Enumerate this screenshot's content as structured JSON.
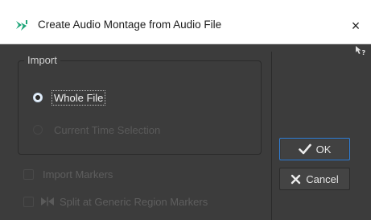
{
  "window": {
    "title": "Create Audio Montage from Audio File",
    "close_label": "×"
  },
  "import_group": {
    "title": "Import",
    "options": [
      {
        "label": "Whole File",
        "checked": true,
        "enabled": true
      },
      {
        "label": "Current Time Selection",
        "checked": false,
        "enabled": false
      }
    ]
  },
  "checkboxes": [
    {
      "label": "Import Markers",
      "checked": false,
      "enabled": false
    },
    {
      "label": "Split at Generic Region Markers",
      "checked": false,
      "enabled": false
    }
  ],
  "buttons": {
    "ok_label": "OK",
    "cancel_label": "Cancel"
  },
  "colors": {
    "accent": "#2f7fd8",
    "app_icon": "#1fa67a",
    "background": "#3c3c3c",
    "titlebar": "#ffffff"
  },
  "icons": {
    "app": "audio-montage-icon",
    "help": "whats-this-help-icon",
    "ok": "checkmark-icon",
    "cancel": "x-icon",
    "split": "region-marker-icon"
  }
}
